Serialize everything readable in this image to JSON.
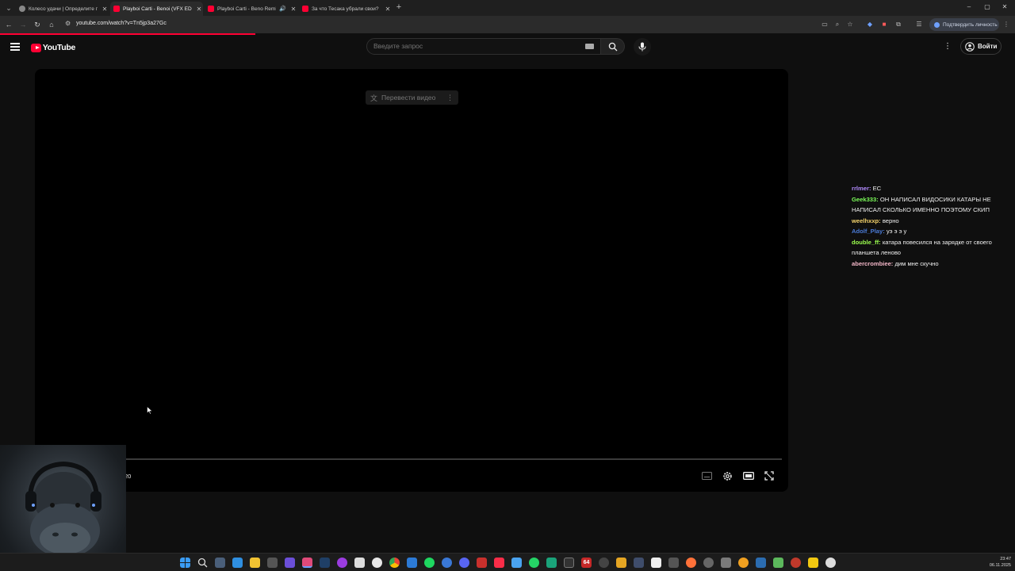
{
  "browser": {
    "tabs": [
      {
        "title": "Колесо удачи | Определите п...",
        "icon": "wheel-favicon",
        "active": false
      },
      {
        "title": "Playboi Carti - Benoi (VFX EDIT)",
        "icon": "youtube-favicon",
        "active": true
      },
      {
        "title": "Playboi Carti - Beno Remix",
        "icon": "youtube-favicon",
        "active": false,
        "audio": true
      },
      {
        "title": "За что Тесака убрали свои? ...",
        "icon": "youtube-favicon",
        "active": false
      }
    ],
    "new_tab": "+",
    "window_controls": {
      "minimize": "–",
      "maximize": "▢",
      "close": "✕"
    },
    "url": "youtube.com/watch?v=Tn5jp3a27Gc",
    "verify_label": "Подтвердить личность"
  },
  "youtube": {
    "logo_text": "YouTube",
    "search_placeholder": "Введите запрос",
    "signin_label": "Войти",
    "accent": "#ff0033"
  },
  "player": {
    "translate_label": "Перевести видео",
    "time_text": "20"
  },
  "chat": [
    {
      "user": "rrlmer:",
      "color": "#b38cff",
      "text": " ЕС"
    },
    {
      "user": "Geek333:",
      "color": "#7dff5a",
      "text": " ОН НАПИСАЛ ВИДОСИКИ КАТАРЫ НЕ НАПИСАЛ СКОЛЬКО ИМЕННО ПОЭТОМУ СКИП"
    },
    {
      "user": "weelhxxp:",
      "color": "#f5d36b",
      "text": " верно"
    },
    {
      "user": "Adolf_Play:",
      "color": "#4a7bd6",
      "text": " уэ э э у"
    },
    {
      "user": "double_ff:",
      "color": "#9cff4f",
      "text": " катара повесился на зарядке от своего планшета леново"
    },
    {
      "user": "abercrombiee:",
      "color": "#f3b6c7",
      "text": " дим мне скучно"
    }
  ],
  "taskbar": {
    "badge": "64",
    "clock_time": "23:47",
    "clock_date": "06.11.2025"
  }
}
